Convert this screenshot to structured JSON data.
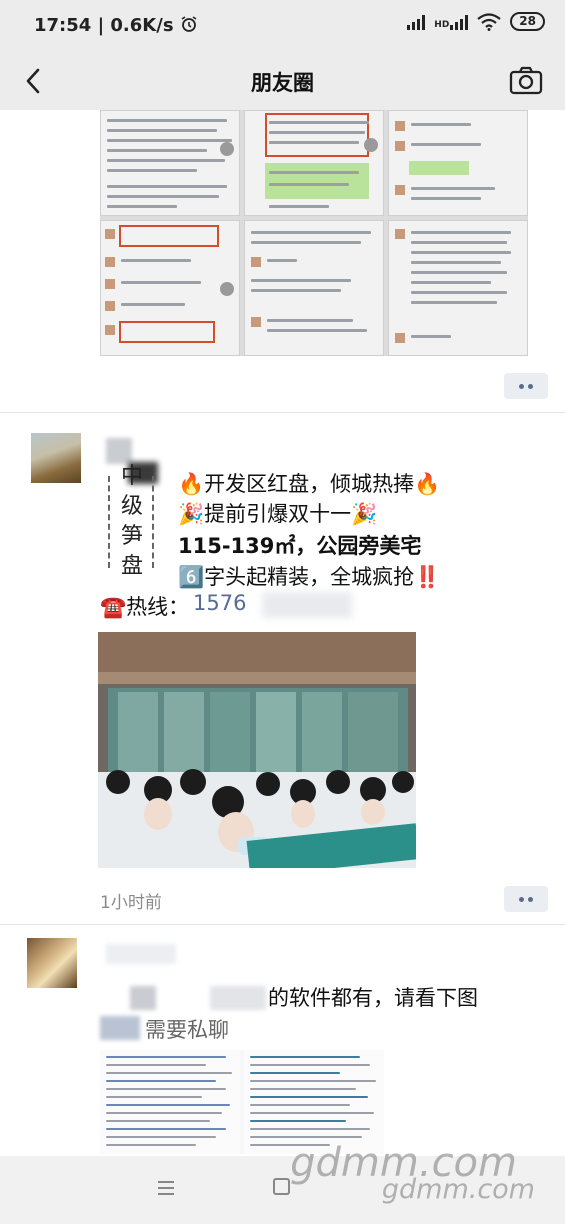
{
  "status_bar": {
    "time": "17:54",
    "network_speed": "0.6K/s",
    "network_type": "HD",
    "battery": "28",
    "icons": [
      "alarm-icon",
      "signal-icon",
      "signal-hd-icon",
      "wifi-icon",
      "battery-icon"
    ]
  },
  "nav": {
    "title": "朋友圈",
    "back_icon": "back-arrow-icon",
    "camera_icon": "camera-icon"
  },
  "post1": {
    "more_icon": "more-dots-icon"
  },
  "post2": {
    "vertical_text": [
      "中",
      "级",
      "笋",
      "盘"
    ],
    "lines": [
      "🔥开发区红盘，倾城热捧🔥",
      "🎉提前引爆双十一🎉",
      "115-139㎡，公园旁美宅",
      "6️⃣字头起精装，全城疯抢‼️"
    ],
    "hotline_label": "☎️热线：",
    "hotline_number": "1576",
    "timestamp": "1小时前",
    "more_icon": "more-dots-icon"
  },
  "post3": {
    "line1": "的软件都有，请看下图",
    "line2": "需要私聊"
  },
  "bottom_nav": {
    "menu_icon": "menu-icon",
    "home_icon": "home-square-icon"
  },
  "watermark": {
    "line1": "gdmm.com",
    "line2": "gdmm.com"
  }
}
